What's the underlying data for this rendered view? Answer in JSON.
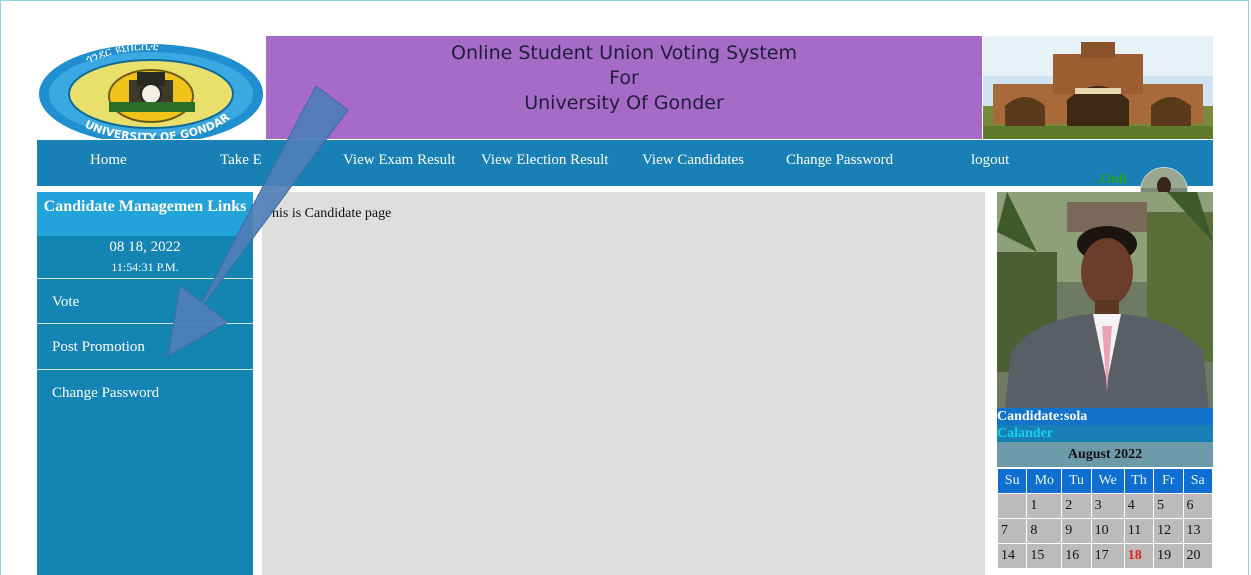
{
  "header": {
    "logo_top_text": "ጎንደር ዩኒቨርሲቲ",
    "logo_bottom_text": "UNIVERSITY OF GONDAR",
    "banner_line1": "Online Student Union Voting System",
    "banner_line2": "For",
    "banner_line3": "University Of Gonder"
  },
  "nav": {
    "items": [
      {
        "label": "Home"
      },
      {
        "label": "Take E"
      },
      {
        "label": "View Exam Result"
      },
      {
        "label": "View Election Result"
      },
      {
        "label": "View Candidates"
      },
      {
        "label": "Change Password"
      },
      {
        "label": "logout"
      }
    ],
    "online_label": ".Onli"
  },
  "sidebar": {
    "title": "Candidate Managemen Links",
    "date": "08 18, 2022",
    "time": "11:54:31 P.M.",
    "links": [
      {
        "label": "Vote"
      },
      {
        "label": "Post Promotion"
      },
      {
        "label": "Change Password"
      }
    ]
  },
  "main": {
    "text": "his is Candidate page"
  },
  "right_panel": {
    "candidate_label": "Candidate:sola",
    "calendar_label": "Calander",
    "month": "August 2022",
    "weekdays": [
      "Su",
      "Mo",
      "Tu",
      "We",
      "Th",
      "Fr",
      "Sa"
    ],
    "weeks": [
      [
        "",
        "1",
        "2",
        "3",
        "4",
        "5",
        "6"
      ],
      [
        "7",
        "8",
        "9",
        "10",
        "11",
        "12",
        "13"
      ],
      [
        "14",
        "15",
        "16",
        "17",
        "18",
        "19",
        "20"
      ]
    ],
    "today": "18"
  },
  "colors": {
    "nav_bg": "#1880b4",
    "banner_bg": "#a66bc6",
    "sidebar_bg": "#1484b3",
    "content_bg": "#dfdedc",
    "arrow": "#4f7fb8"
  }
}
